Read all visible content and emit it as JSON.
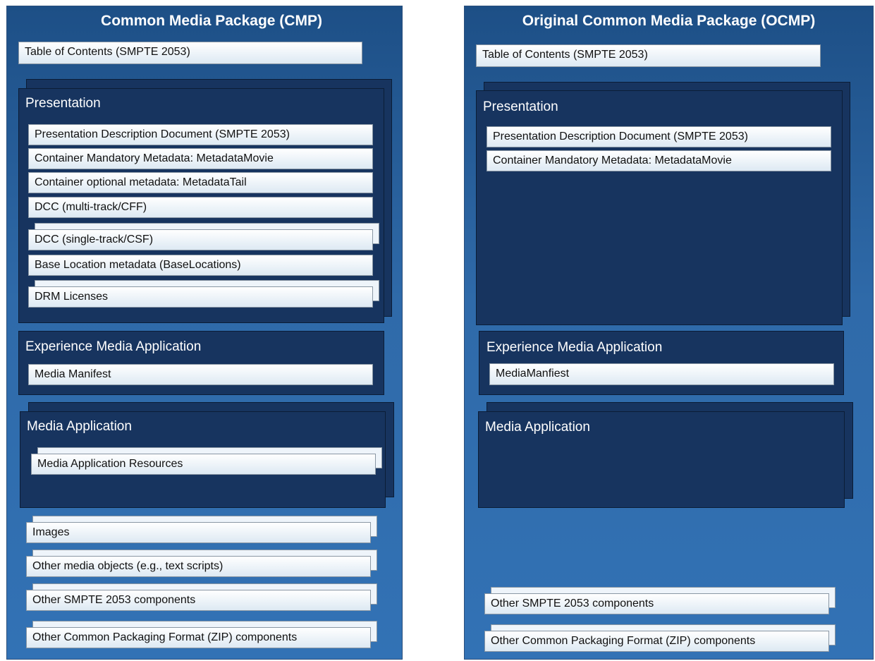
{
  "left": {
    "title": "Common Media Package (CMP)",
    "toc": "Table of Contents (SMPTE 2053)",
    "presentation": {
      "label": "Presentation",
      "items": [
        "Presentation Description Document (SMPTE 2053)",
        "Container Mandatory Metadata: MetadataMovie",
        "Container optional metadata:  MetadataTail",
        "DCC (multi-track/CFF)",
        "DCC (single-track/CSF)",
        "Base Location metadata (BaseLocations)",
        "DRM Licenses"
      ]
    },
    "experience": {
      "label": "Experience Media Application",
      "item": "Media Manifest"
    },
    "media_app": {
      "label": "Media Application",
      "item": "Media Application Resources"
    },
    "bottom": [
      "Images",
      "Other media objects (e.g., text scripts)",
      "Other SMPTE 2053 components",
      "Other Common Packaging Format (ZIP) components"
    ]
  },
  "right": {
    "title": "Original Common Media Package (OCMP)",
    "toc": "Table of Contents (SMPTE 2053)",
    "presentation": {
      "label": "Presentation",
      "items": [
        "Presentation Description Document (SMPTE 2053)",
        "Container Mandatory Metadata: MetadataMovie"
      ]
    },
    "experience": {
      "label": "Experience Media Application",
      "item": "MediaManfiest"
    },
    "media_app": {
      "label": "Media Application"
    },
    "bottom": [
      "Other SMPTE 2053 components",
      "Other Common Packaging Format (ZIP) components"
    ]
  }
}
